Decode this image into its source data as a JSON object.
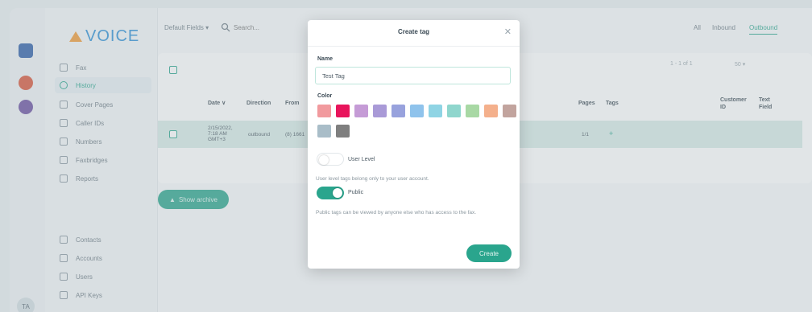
{
  "app": {
    "logo": "VOICE"
  },
  "rail": {
    "avatar_initials": "TA"
  },
  "sidebar": {
    "items": [
      {
        "label": "Fax",
        "icon": "fax-icon"
      },
      {
        "label": "History",
        "icon": "history-icon",
        "active": true
      },
      {
        "label": "Cover Pages",
        "icon": "document-icon"
      },
      {
        "label": "Caller IDs",
        "icon": "id-icon"
      },
      {
        "label": "Numbers",
        "icon": "phone-icon"
      },
      {
        "label": "Faxbridges",
        "icon": "bridge-icon"
      },
      {
        "label": "Reports",
        "icon": "reports-icon"
      }
    ],
    "bottom_items": [
      {
        "label": "Contacts",
        "icon": "contacts-icon"
      },
      {
        "label": "Accounts",
        "icon": "accounts-icon"
      },
      {
        "label": "Users",
        "icon": "users-icon"
      },
      {
        "label": "API Keys",
        "icon": "key-icon"
      }
    ]
  },
  "topbar": {
    "fields_label": "Default Fields ▾",
    "search_placeholder": "Search...",
    "filters": [
      "All",
      "Inbound",
      "Outbound"
    ]
  },
  "table": {
    "pager": "1 - 1 of 1",
    "page_size": "50 ▾",
    "headers": {
      "date": "Date ∨",
      "direction": "Direction",
      "from": "From",
      "pages": "Pages",
      "tags": "Tags",
      "customer_id": "Customer ID",
      "text_field": "Text Field"
    },
    "row": {
      "date": "2/15/2022, 7:18 AM GMT+3",
      "direction": "outbound",
      "from": "(8) 1661",
      "pages": "1/1",
      "tags": "+"
    }
  },
  "show_archive_label": "Show archive",
  "modal": {
    "title": "Create tag",
    "name_label": "Name",
    "name_value": "Test Tag",
    "color_label": "Color",
    "colors": [
      "#f19a9e",
      "#e8155c",
      "#c59bd6",
      "#a99ad7",
      "#98a2dd",
      "#8fc3ec",
      "#8fd4e4",
      "#8fd6cd",
      "#a8d8a4",
      "#f4b08c",
      "#c2a49e",
      "#a9bdc8",
      "#7f7f7f"
    ],
    "user_level_label": "User Level",
    "user_level_help": "User level tags belong only to your user account.",
    "public_label": "Public",
    "public_help": "Public tags can be viewed by anyone else who has access to the fax.",
    "create_label": "Create"
  },
  "colors": {
    "accent": "#2aa58d"
  }
}
